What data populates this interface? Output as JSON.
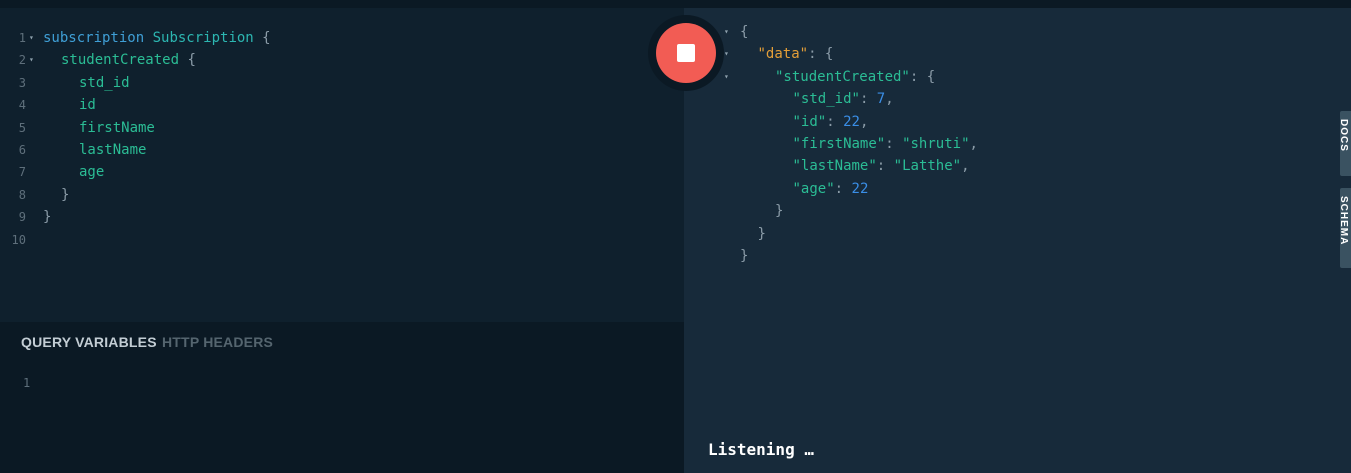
{
  "editor": {
    "lines": [
      {
        "num": "1",
        "fold": "▾",
        "parts": [
          {
            "t": "subscription",
            "c": "kw"
          },
          {
            "t": " ",
            "c": "pn"
          },
          {
            "t": "Subscription",
            "c": "typ"
          },
          {
            "t": " {",
            "c": "pn"
          }
        ],
        "indent": 0
      },
      {
        "num": "2",
        "fold": "▾",
        "parts": [
          {
            "t": "studentCreated",
            "c": "fld"
          },
          {
            "t": " {",
            "c": "pn"
          }
        ],
        "indent": 1
      },
      {
        "num": "3",
        "fold": "",
        "parts": [
          {
            "t": "std_id",
            "c": "fld"
          }
        ],
        "indent": 2
      },
      {
        "num": "4",
        "fold": "",
        "parts": [
          {
            "t": "id",
            "c": "fld"
          }
        ],
        "indent": 2
      },
      {
        "num": "5",
        "fold": "",
        "parts": [
          {
            "t": "firstName",
            "c": "fld"
          }
        ],
        "indent": 2
      },
      {
        "num": "6",
        "fold": "",
        "parts": [
          {
            "t": "lastName",
            "c": "fld"
          }
        ],
        "indent": 2
      },
      {
        "num": "7",
        "fold": "",
        "parts": [
          {
            "t": "age",
            "c": "fld"
          }
        ],
        "indent": 2
      },
      {
        "num": "8",
        "fold": "",
        "parts": [
          {
            "t": "}",
            "c": "pn"
          }
        ],
        "indent": 1
      },
      {
        "num": "9",
        "fold": "",
        "parts": [
          {
            "t": "}",
            "c": "pn"
          }
        ],
        "indent": 0
      },
      {
        "num": "10",
        "fold": "",
        "parts": [],
        "indent": 0
      }
    ]
  },
  "variables_panel": {
    "tab_variables": "QUERY VARIABLES",
    "tab_headers": "HTTP HEADERS",
    "line_number": "1"
  },
  "result": {
    "lines": [
      {
        "fold": "▾",
        "indent": 0,
        "parts": [
          {
            "t": "{",
            "c": "pn"
          }
        ]
      },
      {
        "fold": "▾",
        "indent": 1,
        "parts": [
          {
            "t": "\"data\"",
            "c": "data-key"
          },
          {
            "t": ": {",
            "c": "pn"
          }
        ]
      },
      {
        "fold": "▾",
        "indent": 2,
        "parts": [
          {
            "t": "\"studentCreated\"",
            "c": "key"
          },
          {
            "t": ": {",
            "c": "pn"
          }
        ]
      },
      {
        "fold": "",
        "indent": 3,
        "parts": [
          {
            "t": "\"std_id\"",
            "c": "key"
          },
          {
            "t": ": ",
            "c": "pn"
          },
          {
            "t": "7",
            "c": "num"
          },
          {
            "t": ",",
            "c": "pn"
          }
        ]
      },
      {
        "fold": "",
        "indent": 3,
        "parts": [
          {
            "t": "\"id\"",
            "c": "key"
          },
          {
            "t": ": ",
            "c": "pn"
          },
          {
            "t": "22",
            "c": "num"
          },
          {
            "t": ",",
            "c": "pn"
          }
        ]
      },
      {
        "fold": "",
        "indent": 3,
        "parts": [
          {
            "t": "\"firstName\"",
            "c": "key"
          },
          {
            "t": ": ",
            "c": "pn"
          },
          {
            "t": "\"shruti\"",
            "c": "str"
          },
          {
            "t": ",",
            "c": "pn"
          }
        ]
      },
      {
        "fold": "",
        "indent": 3,
        "parts": [
          {
            "t": "\"lastName\"",
            "c": "key"
          },
          {
            "t": ": ",
            "c": "pn"
          },
          {
            "t": "\"Latthe\"",
            "c": "str"
          },
          {
            "t": ",",
            "c": "pn"
          }
        ]
      },
      {
        "fold": "",
        "indent": 3,
        "parts": [
          {
            "t": "\"age\"",
            "c": "key"
          },
          {
            "t": ": ",
            "c": "pn"
          },
          {
            "t": "22",
            "c": "num"
          }
        ]
      },
      {
        "fold": "",
        "indent": 2,
        "parts": [
          {
            "t": "}",
            "c": "pn"
          }
        ]
      },
      {
        "fold": "",
        "indent": 1,
        "parts": [
          {
            "t": "}",
            "c": "pn"
          }
        ]
      },
      {
        "fold": "",
        "indent": 0,
        "parts": [
          {
            "t": "}",
            "c": "pn"
          }
        ]
      }
    ],
    "status": "Listening …"
  },
  "side_tabs": {
    "docs": "DOCS",
    "schema": "SCHEMA"
  },
  "run_button": {
    "state": "stop",
    "icon": "stop-icon",
    "color": "#f25c54"
  }
}
